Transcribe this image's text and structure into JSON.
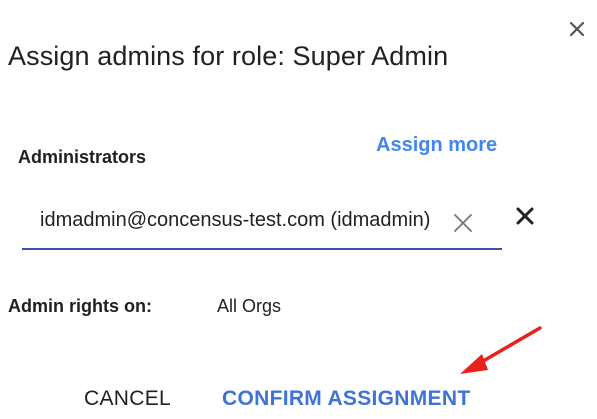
{
  "dialog": {
    "title": "Assign admins for role: Super Admin",
    "close_icon": "close-icon"
  },
  "administrators": {
    "label": "Administrators",
    "assign_more": "Assign more",
    "chip_value": "idmadmin@concensus-test.com (idmadmin)",
    "clear_icon": "close-icon",
    "remove_icon": "close-icon",
    "underline_color": "#3f51b5"
  },
  "rights": {
    "label": "Admin rights on:",
    "value": "All Orgs"
  },
  "annotation": {
    "icon": "red-arrow-icon",
    "color": "#e8211b"
  },
  "actions": {
    "cancel": "CANCEL",
    "confirm": "CONFIRM ASSIGNMENT",
    "confirm_color": "#3f73d8"
  }
}
